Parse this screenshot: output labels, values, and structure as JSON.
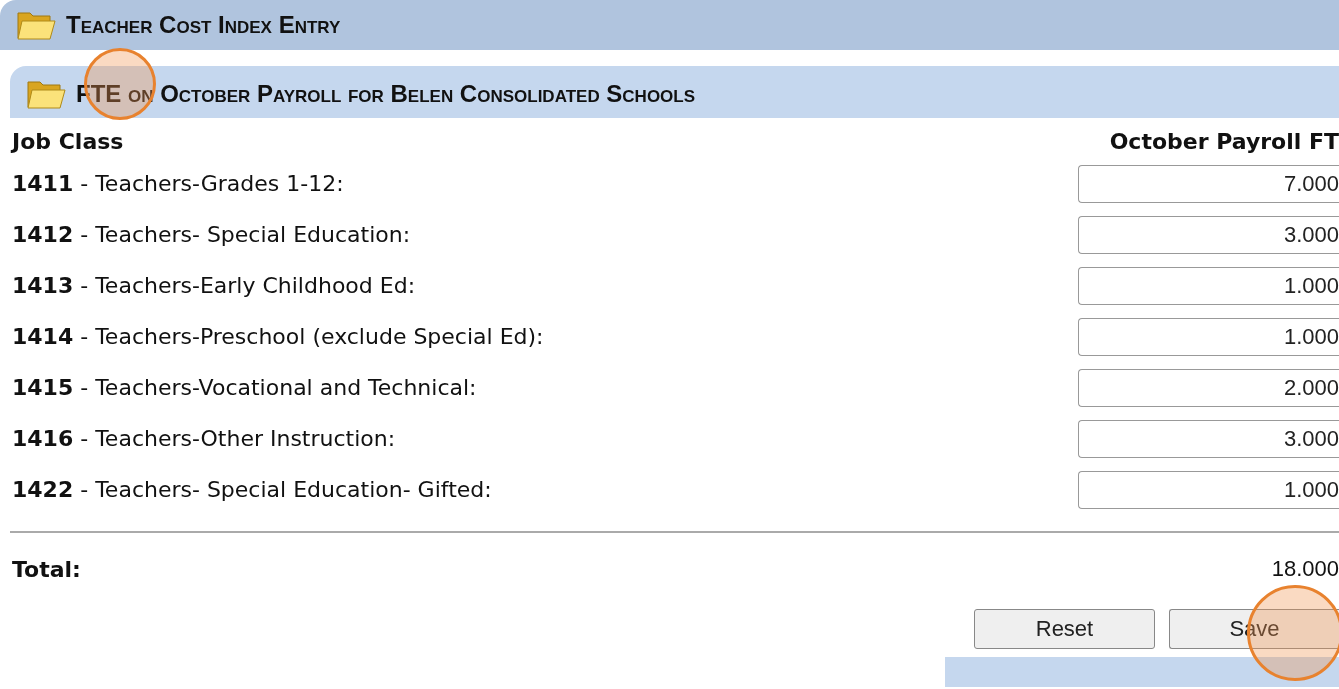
{
  "page_title": "Teacher Cost Index Entry",
  "section": {
    "title": "FTE on October Payroll for Belen Consolidated Schools",
    "columns": [
      "Job Class",
      "October Payroll FT"
    ],
    "rows": [
      {
        "label": "**1411** - Teachers-Grades 1-12:",
        "value": "7.000"
      },
      {
        "label": "**1412** - Teachers- Special Education:",
        "value": "3.000"
      },
      {
        "label": "**1413** - Teachers-Early Childhood Ed:",
        "value": "1.000"
      },
      {
        "label": "**1414** - Teachers-Preschool (exclude Special Ed):",
        "value": "1.000"
      },
      {
        "label": "**1415** - Teachers-Vocational and Technical:",
        "value": "2.000"
      },
      {
        "label": "**1416** - Teachers-Other Instruction:",
        "value": "3.000"
      },
      {
        "label": "**1422** - Teachers- Special Education- Gifted:",
        "value": "1.000"
      }
    ],
    "total_label": "Total:",
    "total_value": "18.000"
  },
  "buttons": [
    "Reset",
    "Save"
  ]
}
